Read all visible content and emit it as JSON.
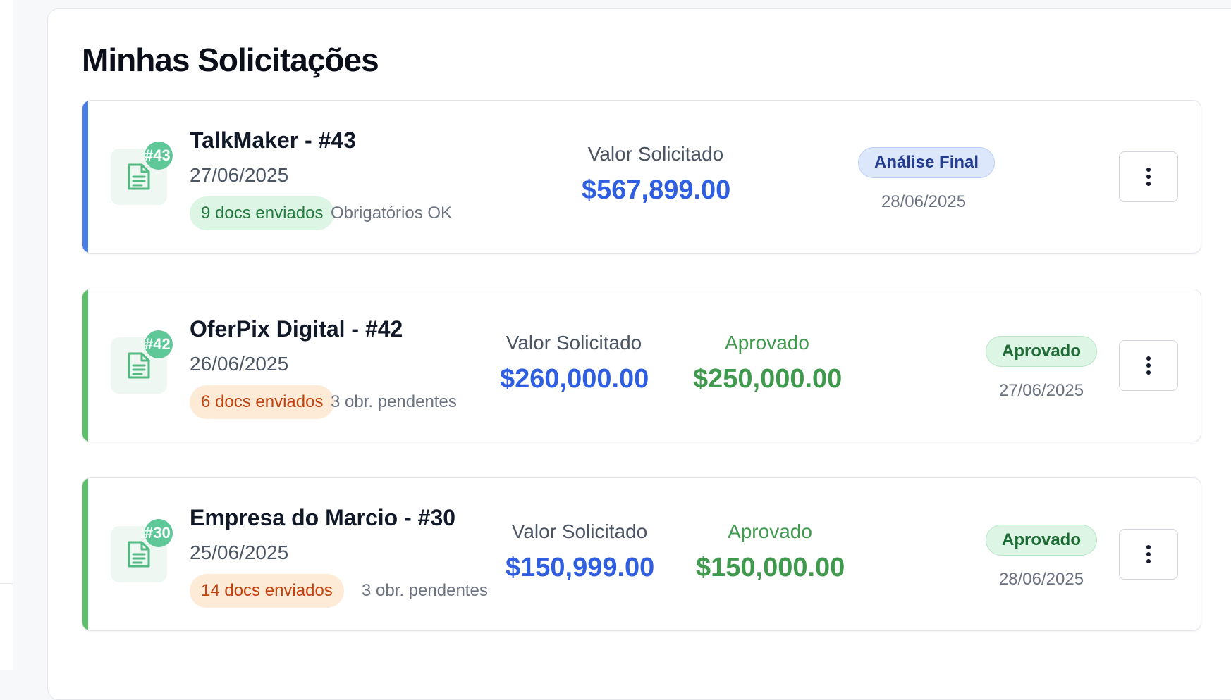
{
  "page": {
    "title": "Minhas Solicitações"
  },
  "requests": [
    {
      "company": "TalkMaker - #43",
      "badge": "#43",
      "date": "27/06/2025",
      "docs": "9 docs enviados",
      "docs_note": "Obrigatórios OK",
      "requested_label": "Valor Solicitado",
      "requested_value": "$567,899.00",
      "approved_label": "",
      "approved_value": "",
      "status": "Análise Final",
      "status_date": "28/06/2025",
      "accent_color": "#4a7ee8"
    },
    {
      "company": "OferPix Digital - #42",
      "badge": "#42",
      "date": "26/06/2025",
      "docs": "6 docs enviados",
      "docs_note": "3 obr. pendentes",
      "requested_label": "Valor Solicitado",
      "requested_value": "$260,000.00",
      "approved_label": "Aprovado",
      "approved_value": "$250,000.00",
      "status": "Aprovado",
      "status_date": "27/06/2025",
      "accent_color": "#5cbf6a"
    },
    {
      "company": "Empresa do Marcio - #30",
      "badge": "#30",
      "date": "25/06/2025",
      "docs": "14 docs enviados",
      "docs_note": "3 obr. pendentes",
      "requested_label": "Valor Solicitado",
      "requested_value": "$150,999.00",
      "approved_label": "Aprovado",
      "approved_value": "$150,000.00",
      "status": "Aprovado",
      "status_date": "28/06/2025",
      "accent_color": "#5cbf6a"
    }
  ],
  "icons": {
    "document": "document-icon",
    "menu": "more-vertical-icon"
  },
  "colors": {
    "requested_value": "#2f5fe0",
    "approved_value": "#3f9a4d",
    "final_review_badge": "#dce7fb",
    "approved_badge": "#dcf5e5"
  }
}
